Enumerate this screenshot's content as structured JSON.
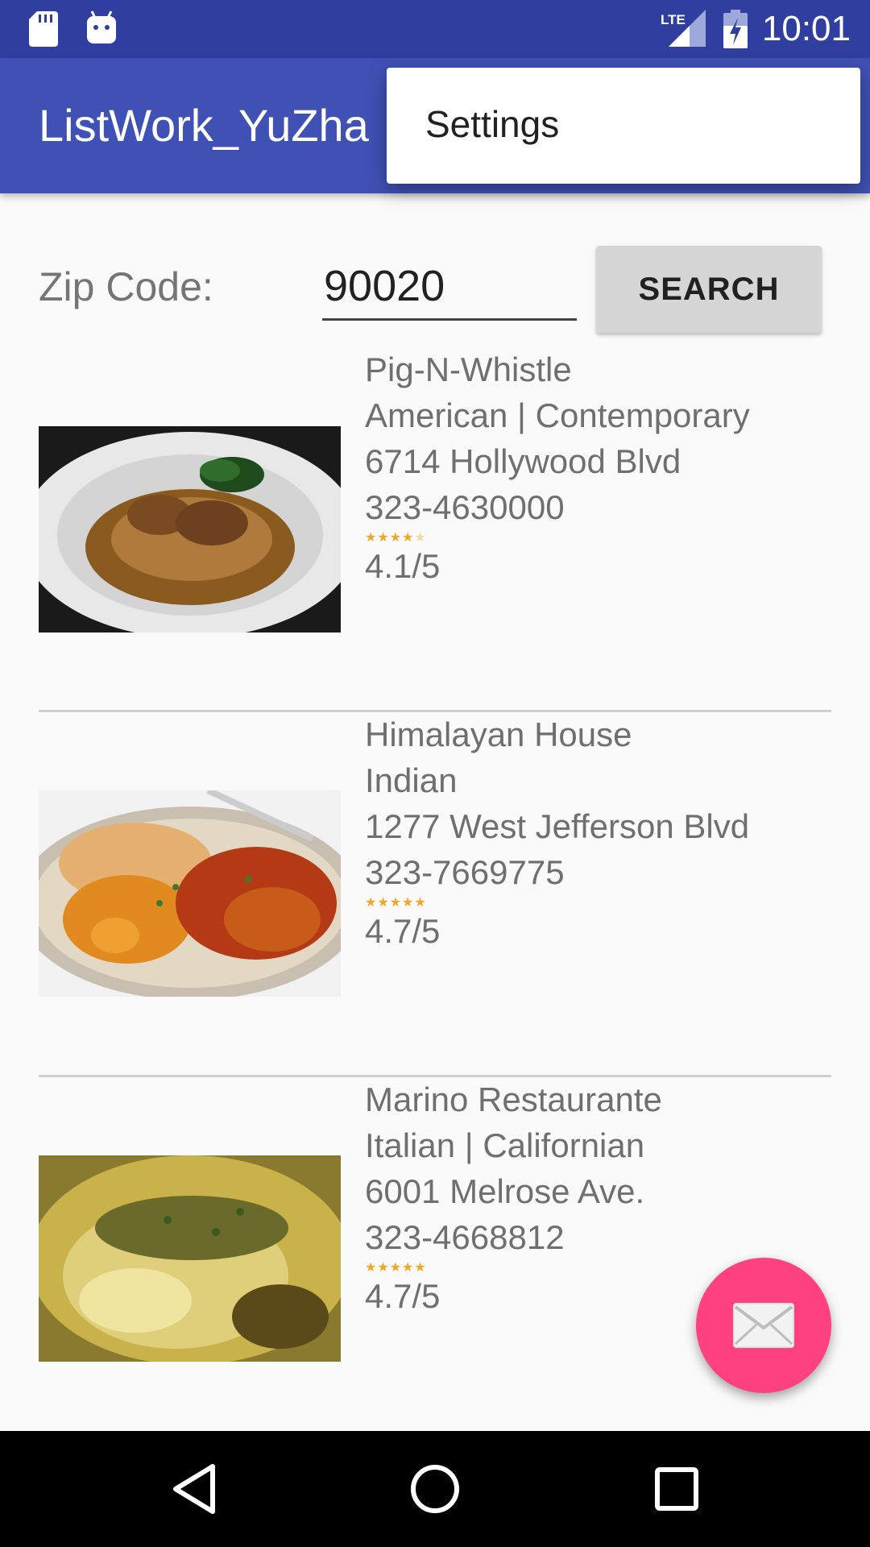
{
  "status_bar": {
    "time": "10:01",
    "network_label": "LTE",
    "icons": [
      "sd-card-icon",
      "android-icon",
      "signal-icon",
      "battery-icon"
    ]
  },
  "app_bar": {
    "title": "ListWork_YuZha"
  },
  "overflow_menu": {
    "items": [
      {
        "label": "Settings"
      }
    ]
  },
  "search": {
    "label": "Zip Code:",
    "value": "90020",
    "button_label": "SEARCH"
  },
  "restaurants": [
    {
      "name": "Pig-N-Whistle",
      "cuisine": "American | Contemporary",
      "address": "6714 Hollywood Blvd",
      "phone": "323-4630000",
      "stars": 4,
      "rating_text": "4.1/5"
    },
    {
      "name": "Himalayan House",
      "cuisine": "Indian",
      "address": "1277 West Jefferson Blvd",
      "phone": "323-7669775",
      "stars": 5,
      "rating_text": "4.7/5"
    },
    {
      "name": "Marino Restaurante",
      "cuisine": "Italian | Californian",
      "address": "6001 Melrose Ave.",
      "phone": "323-4668812",
      "stars": 5,
      "rating_text": "4.7/5"
    }
  ],
  "fab": {
    "icon": "mail-icon",
    "color": "#ff4081"
  },
  "nav_bar": {
    "icons": [
      "back-icon",
      "home-icon",
      "recents-icon"
    ]
  },
  "colors": {
    "primary": "#3f51b5",
    "primary_dark": "#303f9f",
    "accent": "#ff4081",
    "star": "#f5a623"
  }
}
